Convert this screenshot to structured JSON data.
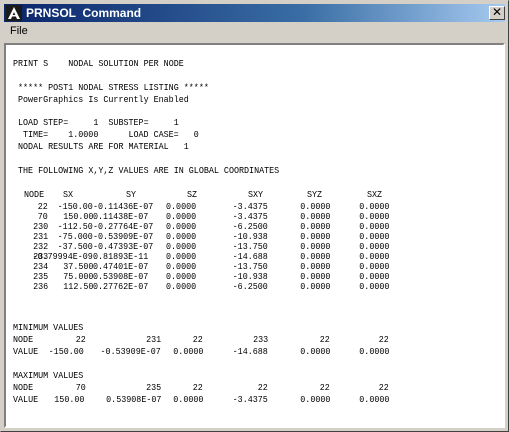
{
  "window": {
    "title": "PRNSOL  Command",
    "close_glyph": "✕"
  },
  "menu": {
    "file_label": "File"
  },
  "listing": {
    "print_line": "PRINT S    NODAL SOLUTION PER NODE",
    "header_line": "***** POST1 NODAL STRESS LISTING *****",
    "powergraphics_line": "PowerGraphics Is Currently Enabled",
    "load_step_line": "LOAD STEP=     1  SUBSTEP=     1",
    "time_line": "TIME=    1.0000      LOAD CASE=   0",
    "material_line": "NODAL RESULTS ARE FOR MATERIAL   1",
    "coordinates_line": "THE FOLLOWING X,Y,Z VALUES ARE IN GLOBAL COORDINATES",
    "columns": [
      "NODE",
      "SX",
      "SY",
      "SZ",
      "SXY",
      "SYZ",
      "SXZ"
    ],
    "rows": [
      [
        "22",
        "-150.00",
        "-0.11436E-07",
        "0.0000",
        "-3.4375",
        "0.0000",
        "0.0000"
      ],
      [
        "70",
        "150.00",
        "0.11438E-07",
        "0.0000",
        "-3.4375",
        "0.0000",
        "0.0000"
      ],
      [
        "230",
        "-112.50",
        "-0.27764E-07",
        "0.0000",
        "-6.2500",
        "0.0000",
        "0.0000"
      ],
      [
        "231",
        "-75.000",
        "-0.53909E-07",
        "0.0000",
        "-10.938",
        "0.0000",
        "0.0000"
      ],
      [
        "232",
        "-37.500",
        "-0.47393E-07",
        "0.0000",
        "-13.750",
        "0.0000",
        "0.0000"
      ],
      [
        "233",
        "-0.79994E-09",
        "0.81893E-11",
        "0.0000",
        "-14.688",
        "0.0000",
        "0.0000"
      ],
      [
        "234",
        "37.500",
        "0.47401E-07",
        "0.0000",
        "-13.750",
        "0.0000",
        "0.0000"
      ],
      [
        "235",
        "75.000",
        "0.53908E-07",
        "0.0000",
        "-10.938",
        "0.0000",
        "0.0000"
      ],
      [
        "236",
        "112.50",
        "0.27762E-07",
        "0.0000",
        "-6.2500",
        "0.0000",
        "0.0000"
      ]
    ],
    "minimum": {
      "title": "MINIMUM VALUES",
      "node_label": "NODE",
      "value_label": "VALUE",
      "nodes": [
        "22",
        "231",
        "22",
        "233",
        "22",
        "22"
      ],
      "values": [
        "-150.00",
        "-0.53909E-07",
        "0.0000",
        "-14.688",
        "0.0000",
        "0.0000"
      ]
    },
    "maximum": {
      "title": "MAXIMUM VALUES",
      "node_label": "NODE",
      "value_label": "VALUE",
      "nodes": [
        "70",
        "235",
        "22",
        "22",
        "22",
        "22"
      ],
      "values": [
        "150.00",
        "0.53908E-07",
        "0.0000",
        "-3.4375",
        "0.0000",
        "0.0000"
      ]
    }
  }
}
